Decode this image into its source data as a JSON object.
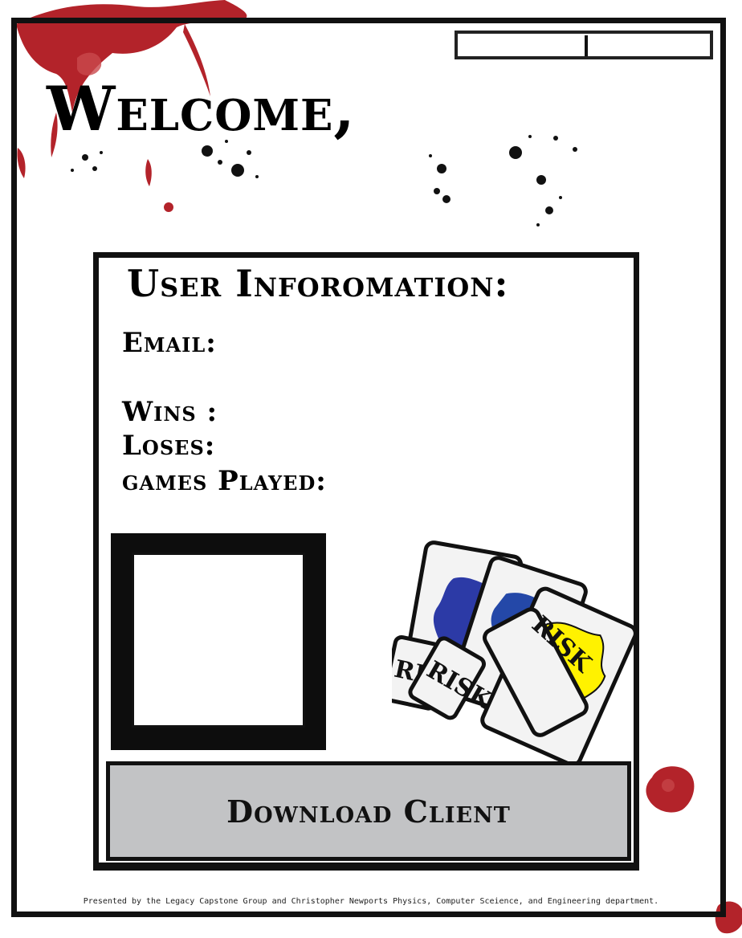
{
  "header": {
    "welcome_text": "Welcome,",
    "user_field_value": ""
  },
  "user_info": {
    "title": "User Inforomation:",
    "email_label": "Email:",
    "email_value": "",
    "wins_label": "Wins :",
    "wins_value": "",
    "loses_label": "Loses:",
    "loses_value": "",
    "games_played_label": "games Played:",
    "games_played_value": ""
  },
  "cards": {
    "card_label": "RISK",
    "colors": [
      "#2c3aa6",
      "#2448a8",
      "#fff200"
    ]
  },
  "actions": {
    "download_label": "Download Client"
  },
  "footer": {
    "credit": "Presented by the Legacy Capstone Group and Christopher Newports Physics, Computer Sceience, and Engineering department."
  },
  "theme": {
    "blood_red": "#b3232a",
    "ink": "#111111",
    "button_gray": "#c2c3c5"
  }
}
